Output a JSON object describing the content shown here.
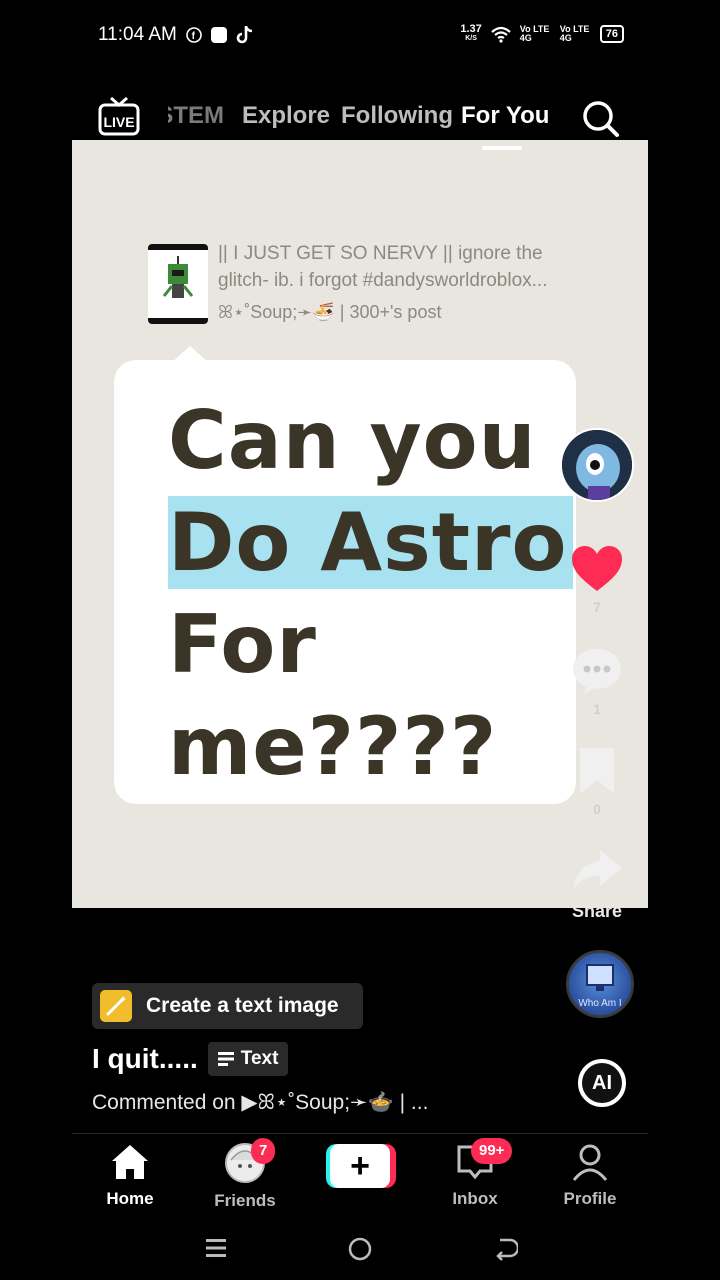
{
  "status_bar": {
    "time": "11:04 AM",
    "net_speed": "1.37",
    "net_unit": "K/S",
    "sim1": "Vo LTE 4G",
    "sim2": "Vo LTE 4G",
    "battery": "76"
  },
  "top_nav": {
    "live_label": "LIVE",
    "tabs": [
      "STEM",
      "Explore",
      "Following",
      "For You"
    ],
    "active_tab": "For You"
  },
  "post": {
    "title": "|| I JUST GET SO NERVY || ignore the glitch- ib. i forgot #dandysworldroblox...",
    "author": "ꕤ⋆˚Soup;➛🍜 | 300+'s post",
    "bubble_lines": [
      "Can you",
      "Do Astro",
      "For",
      "me????"
    ]
  },
  "side_rail": {
    "likes": "7",
    "comments": "1",
    "saves": "0",
    "share_label": "Share",
    "music_label": "Who Am I"
  },
  "caption": {
    "create_chip": "Create a text image",
    "title": "I quit.....",
    "text_badge": "Text",
    "commented_on": "Commented on  ▶ꕤ⋆˚Soup;➛🍲  | ..."
  },
  "ai_label": "AI",
  "bottom_nav": {
    "home": "Home",
    "friends": "Friends",
    "friends_badge": "7",
    "inbox": "Inbox",
    "inbox_badge": "99+",
    "profile": "Profile"
  },
  "colors": {
    "accent_red": "#fe2c55",
    "accent_cyan": "#25f4ee",
    "video_bg": "#e8e6de",
    "highlight": "#a8e2f0"
  }
}
